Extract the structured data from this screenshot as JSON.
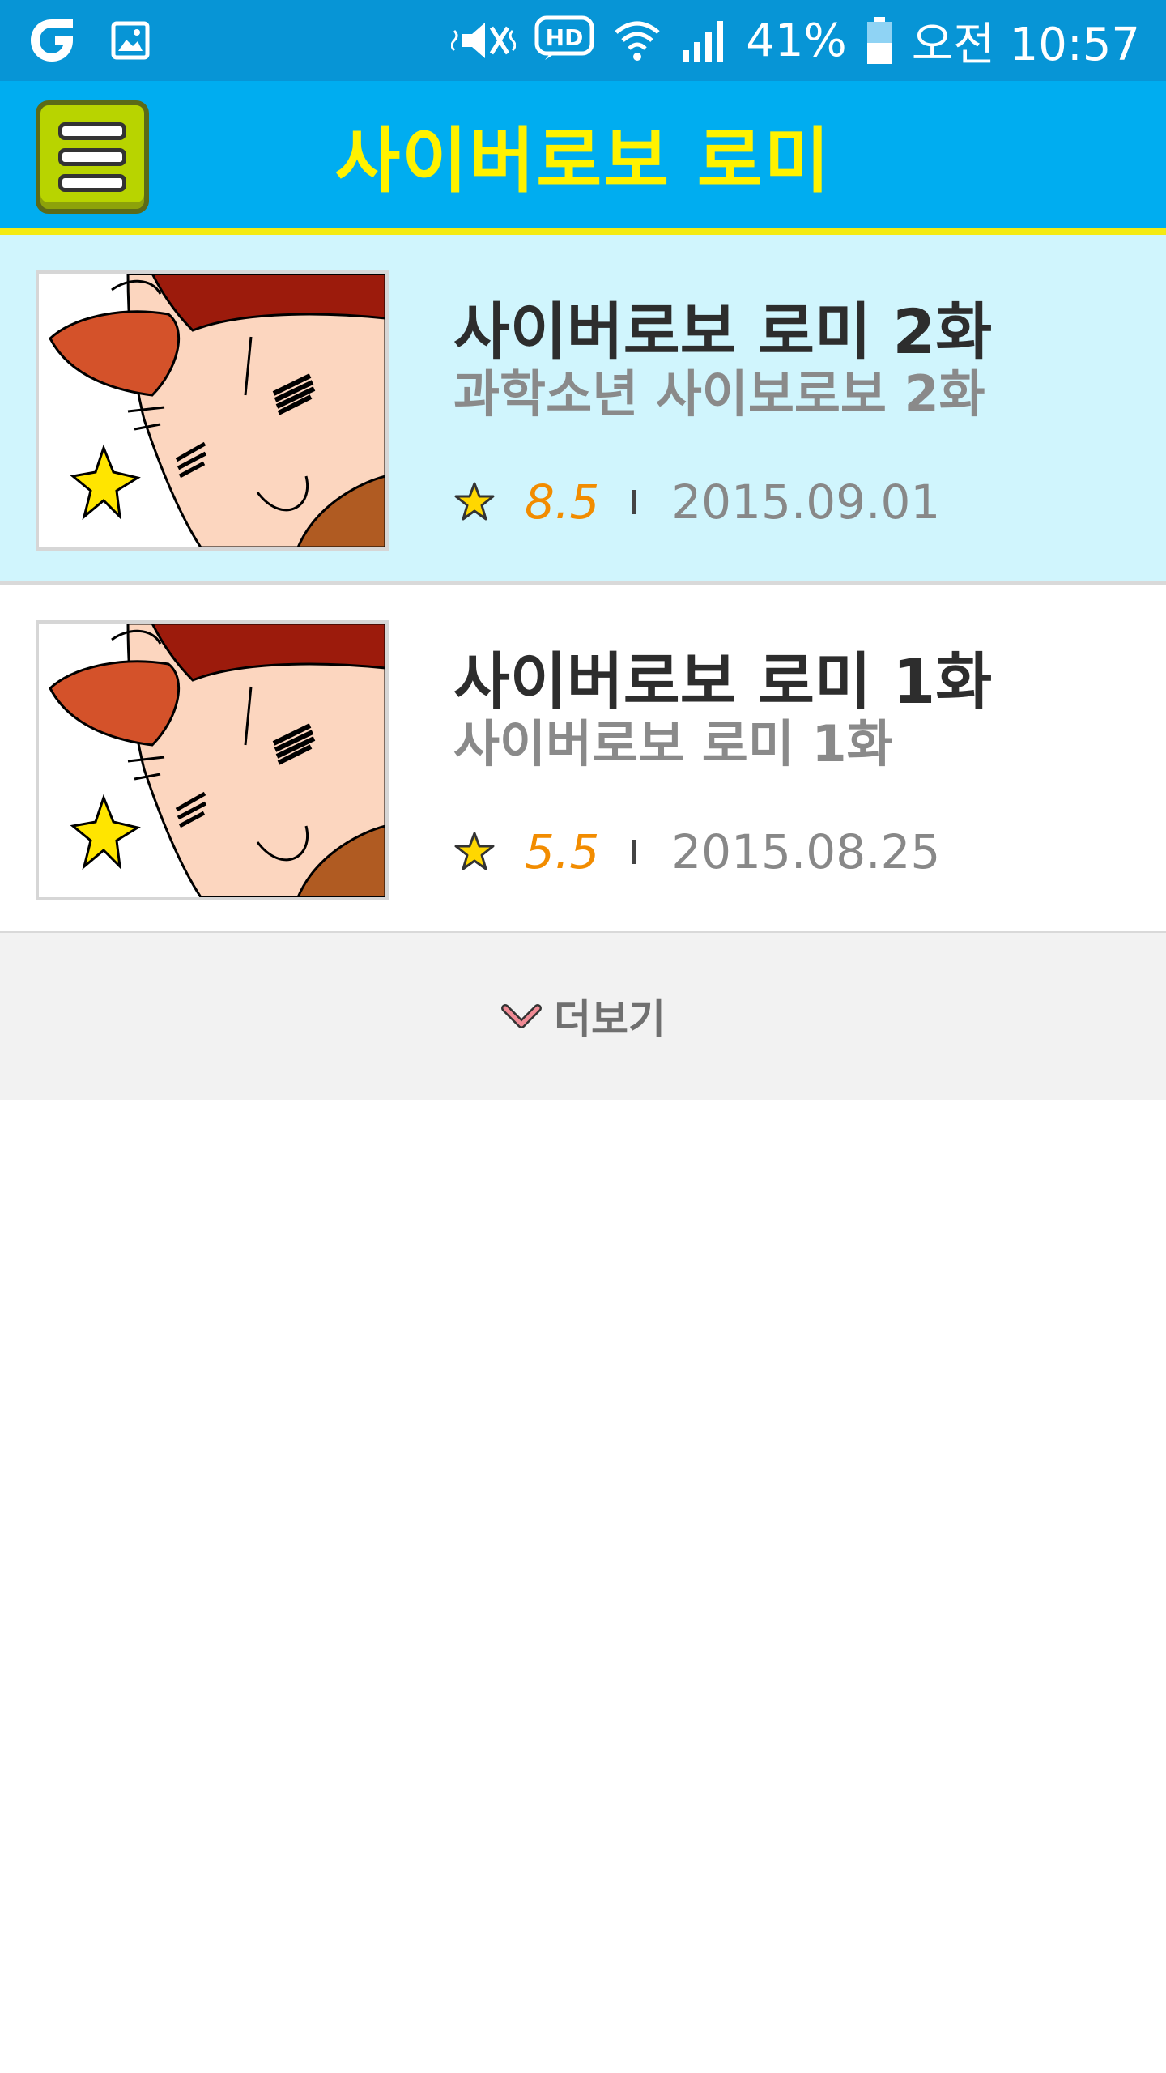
{
  "status_bar": {
    "battery_percent": "41%",
    "time": "오전 10:57",
    "icons": [
      "carrier-icon",
      "gallery-icon",
      "mute-icon",
      "hd-voice-icon",
      "wifi-icon",
      "signal-icon",
      "battery-icon"
    ]
  },
  "header": {
    "title": "사이버로보 로미",
    "menu_icon": "hamburger-menu-icon",
    "background_color": "#00adf0",
    "title_color": "#fff200"
  },
  "episodes": [
    {
      "title": "사이버로보 로미 2화",
      "subtitle": "과학소년 사이보로보 2화",
      "rating": "8.5",
      "date": "2015.09.01",
      "highlighted": true
    },
    {
      "title": "사이버로보 로미 1화",
      "subtitle": "사이버로보 로미 1화",
      "rating": "5.5",
      "date": "2015.08.25",
      "highlighted": false
    }
  ],
  "more": {
    "label": "더보기",
    "icon": "chevron-down-icon"
  },
  "colors": {
    "status_bar": "#0795d6",
    "header_border": "#f4ea12",
    "highlight_row": "#d0f5fd",
    "rating": "#f28c00"
  }
}
